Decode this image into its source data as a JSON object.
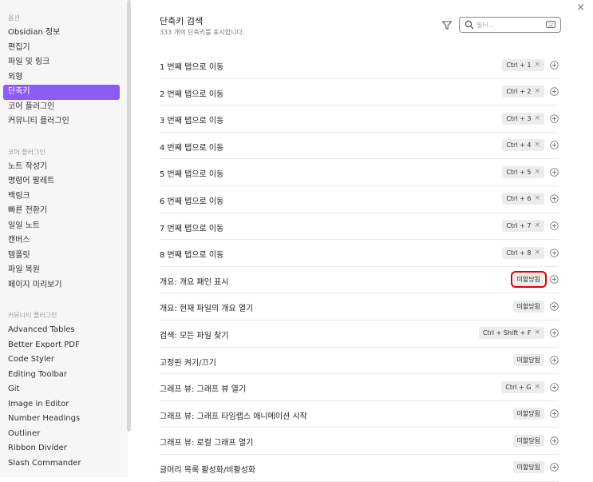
{
  "sidebar": {
    "options_head": "옵션",
    "options": [
      "Obsidian 정보",
      "편집기",
      "파일 및 링크",
      "외형",
      "단축키",
      "코어 플러그인",
      "커뮤니티 플러그인"
    ],
    "active_index": 4,
    "core_head": "코어 플러그인",
    "core": [
      "노트 작성기",
      "명령어 팔레트",
      "백링크",
      "빠른 전환기",
      "일일 노트",
      "캔버스",
      "템플릿",
      "파일 복원",
      "페이지 미리보기"
    ],
    "community_head": "커뮤니티 플러그인",
    "community": [
      "Advanced Tables",
      "Better Export PDF",
      "Code Styler",
      "Editing Toolbar",
      "Git",
      "Image in Editor",
      "Number Headings",
      "Outliner",
      "Ribbon Divider",
      "Slash Commander"
    ]
  },
  "header": {
    "title": "단축키 검색",
    "subtitle": "333 개의 단축키를 표시합니다."
  },
  "search": {
    "placeholder": "필터...",
    "value": ""
  },
  "rows": [
    {
      "name": "1 번째 탭으로 이동",
      "hotkey": "Ctrl + 1"
    },
    {
      "name": "2 번째 탭으로 이동",
      "hotkey": "Ctrl + 2"
    },
    {
      "name": "3 번째 탭으로 이동",
      "hotkey": "Ctrl + 3"
    },
    {
      "name": "4 번째 탭으로 이동",
      "hotkey": "Ctrl + 4"
    },
    {
      "name": "5 번째 탭으로 이동",
      "hotkey": "Ctrl + 5"
    },
    {
      "name": "6 번째 탭으로 이동",
      "hotkey": "Ctrl + 6"
    },
    {
      "name": "7 번째 탭으로 이동",
      "hotkey": "Ctrl + 7"
    },
    {
      "name": "8 번째 탭으로 이동",
      "hotkey": "Ctrl + 8"
    },
    {
      "name": "개요: 개요 패인 표시",
      "unassigned": "미할당됨",
      "highlight": true
    },
    {
      "name": "개요: 현재 파일의 개요 열기",
      "unassigned": "미할당됨"
    },
    {
      "name": "검색: 모든 파일 찾기",
      "hotkey": "Ctrl + Shift + F"
    },
    {
      "name": "고정핀 켜기/끄기",
      "unassigned": "미할당됨"
    },
    {
      "name": "그래프 뷰: 그래프 뷰 열기",
      "hotkey": "Ctrl + G"
    },
    {
      "name": "그래프 뷰: 그래프 타임랩스 애니메이션 시작",
      "unassigned": "미할당됨"
    },
    {
      "name": "그래프 뷰: 로컬 그래프 열기",
      "unassigned": "미할당됨"
    },
    {
      "name": "글머리 목록 활성화/비활성화",
      "unassigned": "미할당됨"
    }
  ],
  "icons": {
    "close": "close-icon",
    "filter": "filter-icon",
    "search": "search-icon",
    "keyboard": "keyboard-icon",
    "remove": "x-icon",
    "add": "plus-circle-icon"
  },
  "colors": {
    "accent": "#8b5cf6",
    "highlight": "#e00000"
  },
  "close_glyph": "×",
  "remove_glyph": "×"
}
